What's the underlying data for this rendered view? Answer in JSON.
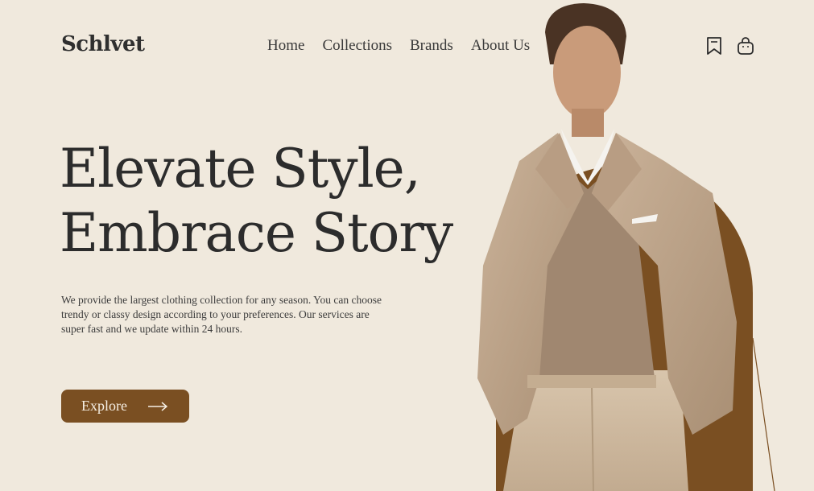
{
  "brand": {
    "logo": "Schlvet"
  },
  "nav": {
    "items": [
      "Home",
      "Collections",
      "Brands",
      "About Us"
    ]
  },
  "header_icons": {
    "bookmark": "bookmark-icon",
    "bag": "shopping-bag-icon"
  },
  "hero": {
    "title_line1": "Elevate Style,",
    "title_line2": "Embrace Story",
    "description": "We provide the largest clothing collection for any season. You can choose trendy or classy design according to your preferences. Our services are super fast and we update within 24 hours.",
    "cta_label": "Explore"
  },
  "colors": {
    "background": "#f0e9dd",
    "accent": "#7a4f22",
    "text": "#2c2c2c"
  }
}
